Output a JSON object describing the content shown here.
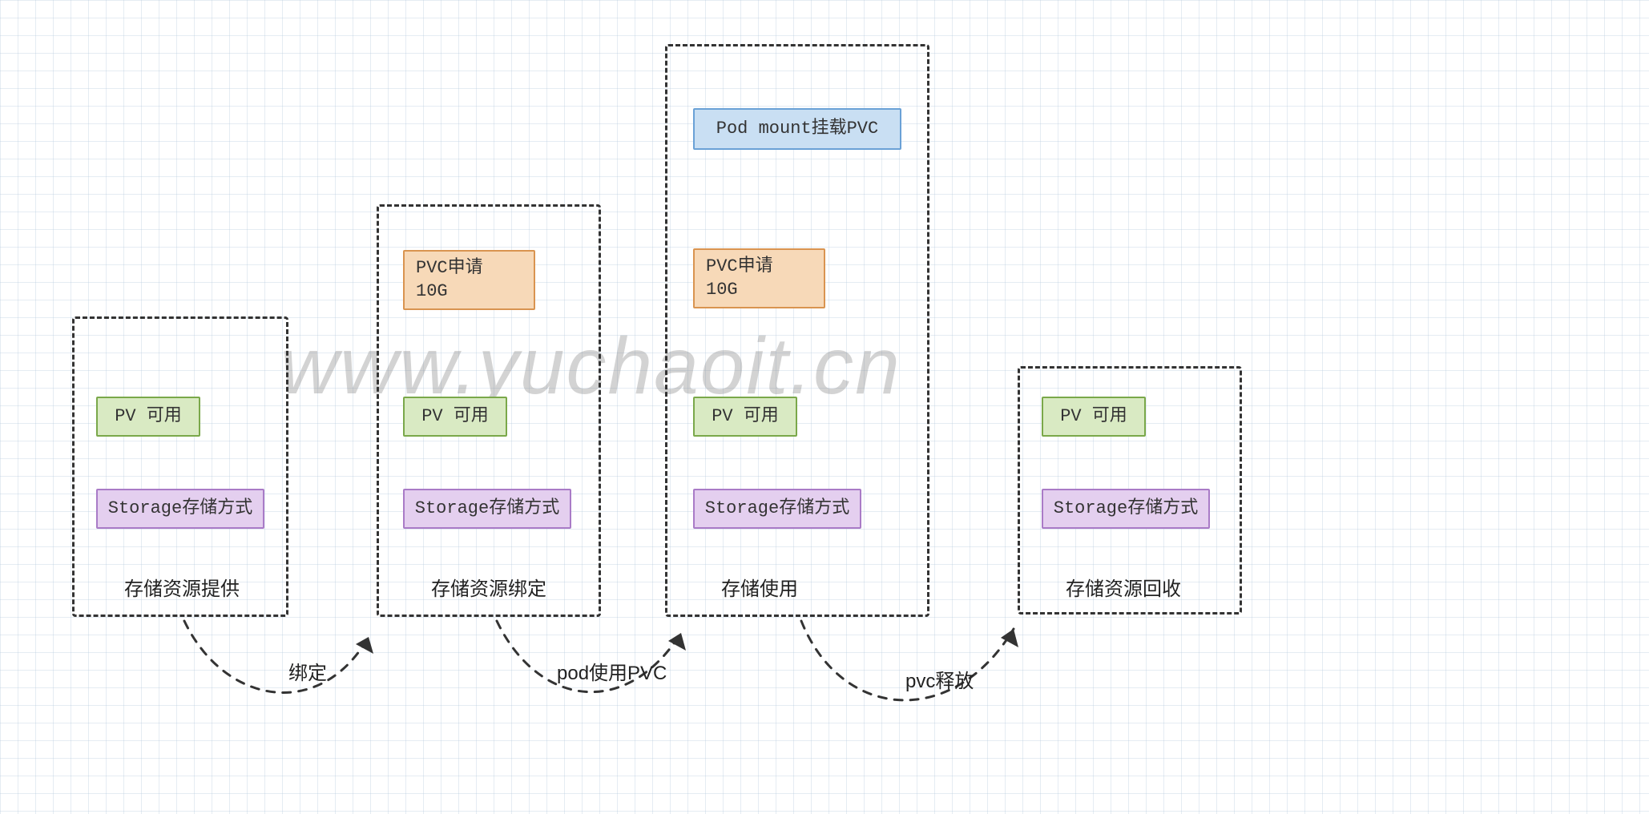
{
  "watermark": "www.yuchaoit.cn",
  "stages": {
    "s1": {
      "pv": "PV 可用",
      "storage": "Storage存储方式",
      "label": "存储资源提供"
    },
    "s2": {
      "pvc": "PVC申请\n10G",
      "pv": "PV 可用",
      "storage": "Storage存储方式",
      "label": "存储资源绑定"
    },
    "s3": {
      "pod": "Pod mount挂载PVC",
      "pvc": "PVC申请\n10G",
      "pv": "PV 可用",
      "storage": "Storage存储方式",
      "label": "存储使用"
    },
    "s4": {
      "pv": "PV 可用",
      "storage": "Storage存储方式",
      "label": "存储资源回收"
    }
  },
  "arrows": {
    "a1": "绑定",
    "a2": "pod使用PVC",
    "a3": "pvc释放"
  }
}
